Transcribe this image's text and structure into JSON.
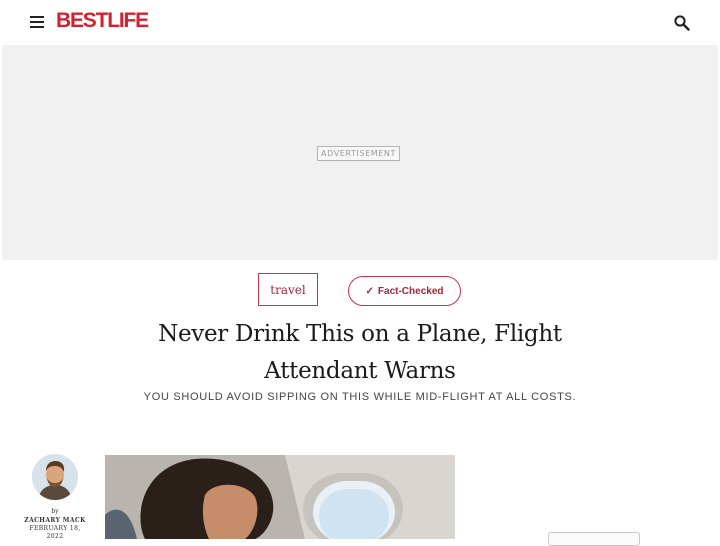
{
  "header": {
    "logo_text": "BESTLIFE",
    "menu_icon": "hamburger-menu-icon",
    "search_icon": "search-icon",
    "brand_color": "#d3212f"
  },
  "ad": {
    "label": "ADVERTISEMENT"
  },
  "article": {
    "category": "travel",
    "fact_check_label": "Fact-Checked",
    "fact_check_icon": "checkmark-icon",
    "title_line1": "Never Drink This on a Plane, Flight",
    "title_line2": "Attendant Warns",
    "subtitle": "YOU SHOULD AVOID SIPPING ON THIS WHILE MID-FLIGHT AT ALL COSTS.",
    "accent_color": "#c3364a"
  },
  "author": {
    "by_label": "by",
    "name": "ZACHARY MACK",
    "date": "FEBRUARY 18,",
    "date_year": "2022"
  }
}
